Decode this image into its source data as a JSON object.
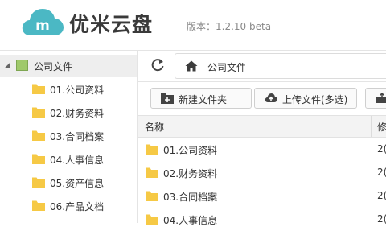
{
  "header": {
    "brand": "优米云盘",
    "version": "版本：1.2.10 beta",
    "logo_letter": "m"
  },
  "sidebar": {
    "root_label": "公司文件",
    "items": [
      {
        "label": "01.公司资料"
      },
      {
        "label": "02.财务资料"
      },
      {
        "label": "03.合同档案"
      },
      {
        "label": "04.人事信息"
      },
      {
        "label": "05.资产信息"
      },
      {
        "label": "06.产品文档"
      }
    ]
  },
  "navbar": {
    "path": "公司文件"
  },
  "toolbar": {
    "new_folder": "新建文件夹",
    "upload": "上传文件(多选)"
  },
  "table": {
    "headers": {
      "name": "名称",
      "modified": "修"
    },
    "rows": [
      {
        "name": "01.公司资料",
        "modified": "2("
      },
      {
        "name": "02.财务资料",
        "modified": "2("
      },
      {
        "name": "03.合同档案",
        "modified": "2("
      },
      {
        "name": "04.人事信息",
        "modified": "2("
      }
    ]
  },
  "colors": {
    "accent": "#4bb8c4",
    "folder": "#f6c945",
    "root_folder": "#9fc96b"
  }
}
